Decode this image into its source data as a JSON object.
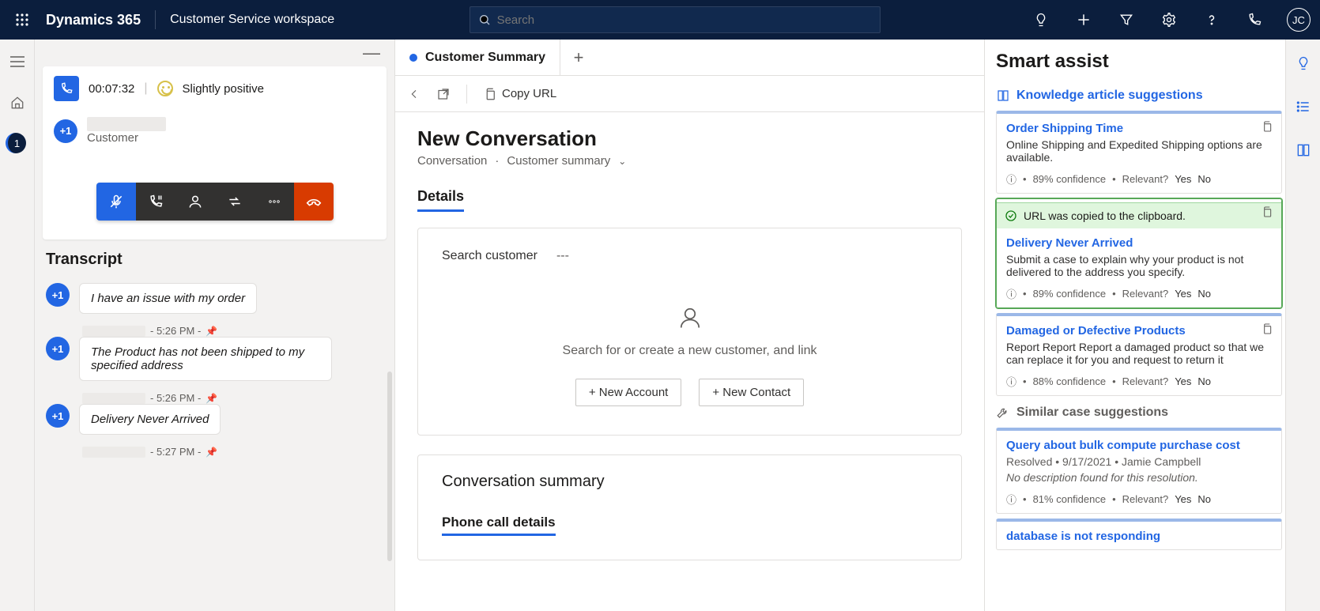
{
  "topbar": {
    "brand": "Dynamics 365",
    "workspace": "Customer Service workspace",
    "search_placeholder": "Search",
    "avatar_initials": "JC"
  },
  "rail": {
    "session_badge": "1"
  },
  "conversation": {
    "timer": "00:07:32",
    "sentiment": "Slightly positive",
    "customer_badge": "+1",
    "customer_label": "Customer",
    "transcript_heading": "Transcript",
    "messages": [
      {
        "badge": "+1",
        "text": "I have an issue with my order",
        "time": "- 5:26 PM -"
      },
      {
        "badge": "+1",
        "text": "The Product has not been shipped to my specified address",
        "time": "- 5:26 PM -"
      },
      {
        "badge": "+1",
        "text": "Delivery Never Arrived",
        "time": "- 5:27 PM -"
      }
    ]
  },
  "main": {
    "tab_label": "Customer Summary",
    "copy_url": "Copy URL",
    "title": "New Conversation",
    "breadcrumb1": "Conversation",
    "breadcrumb2": "Customer summary",
    "details_tab": "Details",
    "search_customer": "Search customer",
    "search_customer_value": "---",
    "empty_text": "Search for or create a new customer, and link",
    "new_account": "+ New Account",
    "new_contact": "+ New Contact",
    "conv_summary": "Conversation summary",
    "phone_details": "Phone call details"
  },
  "assist": {
    "heading": "Smart assist",
    "kb_heading": "Knowledge article suggestions",
    "toast": "URL was copied to the clipboard.",
    "cases_heading": "Similar case suggestions",
    "kb": [
      {
        "title": "Order Shipping Time",
        "desc": "Online Shipping and Expedited Shipping options are available.",
        "conf": "89% confidence",
        "rel": "Relevant?",
        "yes": "Yes",
        "no": "No"
      },
      {
        "title": "Delivery Never Arrived",
        "desc": "Submit a case to explain why your product is not delivered to the address you specify.",
        "conf": "89% confidence",
        "rel": "Relevant?",
        "yes": "Yes",
        "no": "No"
      },
      {
        "title": "Damaged or Defective Products",
        "desc": "Report Report Report a damaged product so that we can replace it for you and request to return it",
        "conf": "88% confidence",
        "rel": "Relevant?",
        "yes": "Yes",
        "no": "No"
      }
    ],
    "cases": [
      {
        "title": "Query about bulk compute purchase cost",
        "meta": "Resolved • 9/17/2021 • Jamie Campbell",
        "desc": "No description found for this resolution.",
        "conf": "81% confidence",
        "rel": "Relevant?",
        "yes": "Yes",
        "no": "No"
      },
      {
        "title": "database is not responding",
        "meta": "",
        "desc": "",
        "conf": "",
        "rel": "",
        "yes": "",
        "no": ""
      }
    ]
  }
}
